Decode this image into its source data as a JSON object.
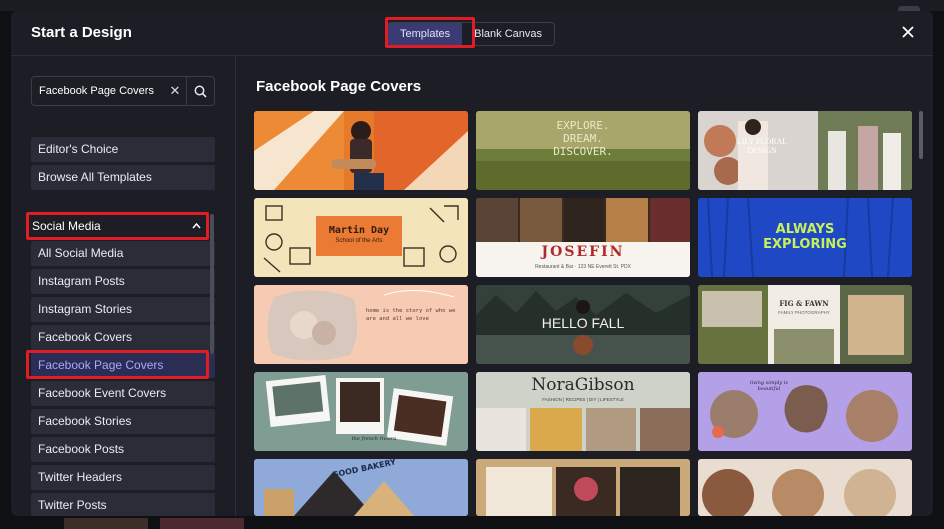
{
  "dialog": {
    "title": "Start a Design",
    "close_icon": "×",
    "tabs": [
      {
        "label": "Templates",
        "active": true
      },
      {
        "label": "Blank Canvas",
        "active": false
      }
    ]
  },
  "sidebar": {
    "search": {
      "value": "Facebook Page Covers",
      "clear_icon": "✕",
      "search_icon": "search-icon"
    },
    "top_items": [
      "Editor's Choice",
      "Browse All Templates"
    ],
    "category": {
      "label": "Social Media",
      "chevron": "⌃"
    },
    "items": [
      {
        "label": "All Social Media"
      },
      {
        "label": "Instagram Posts"
      },
      {
        "label": "Instagram Stories"
      },
      {
        "label": "Facebook Covers"
      },
      {
        "label": "Facebook Page Covers",
        "selected": true
      },
      {
        "label": "Facebook Event Covers"
      },
      {
        "label": "Facebook Stories"
      },
      {
        "label": "Facebook Posts"
      },
      {
        "label": "Twitter Headers"
      },
      {
        "label": "Twitter Posts"
      }
    ]
  },
  "main": {
    "title": "Facebook Page Covers",
    "templates": [
      {
        "text": ""
      },
      {
        "text": "EXPLORE.\nDREAM.\nDISCOVER."
      },
      {
        "text": "LILY FLORAL DESIGN"
      },
      {
        "text": "Martin Day",
        "sub": "School of the Arts"
      },
      {
        "text": "JOSEFIN",
        "sub": "Restaurant & Bar · 123 NE Everett St. PDX"
      },
      {
        "text": "ALWAYS\nEXPLORING"
      },
      {
        "text": "home is the story of who we are and all we love"
      },
      {
        "text": "HELLO FALL"
      },
      {
        "text": "FIG & FAWN",
        "sub": "FAMILY PHOTOGRAPHY"
      },
      {
        "text": "the french riviera"
      },
      {
        "text": "NoraGibson",
        "sub": "FASHION | RECIPES | DIY | LIFESTYLE"
      },
      {
        "text": "living simply is beautiful"
      },
      {
        "text": "GOOD BAKERY"
      },
      {
        "text": ""
      },
      {
        "text": ""
      }
    ]
  },
  "colors": {
    "accent": "#3b3b73",
    "highlight": "#e01c24",
    "panel": "#1c1d25",
    "item": "#2a2c38"
  }
}
